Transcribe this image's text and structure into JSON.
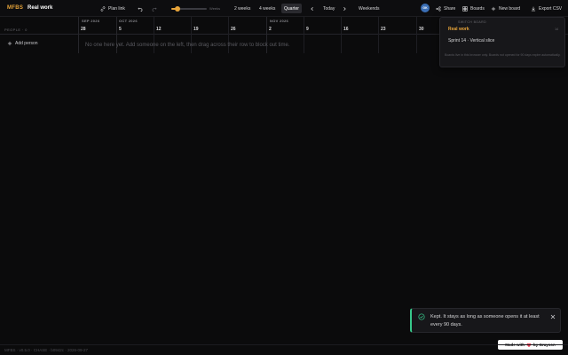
{
  "app": {
    "logo": "MFBS",
    "board_title": "Real work"
  },
  "toolbar": {
    "plan_link": "Plan link",
    "zoom_label": "Weeks",
    "zoom_level": 0.18,
    "views": [
      "2 weeks",
      "4 weeks",
      "Quarter"
    ],
    "active_view": "Quarter",
    "today": "Today",
    "weekends": "Weekends",
    "avatar_initials": "GK",
    "share": "Share",
    "boards": "Boards",
    "new_board": "New board",
    "export_csv": "Export CSV"
  },
  "timeline": {
    "people_label": "PEOPLE · 0",
    "months": [
      "SEP 2026",
      "OCT 2026",
      "NOV 2026"
    ],
    "days": [
      "28",
      "5",
      "12",
      "19",
      "26",
      "2",
      "9",
      "16",
      "23",
      "30"
    ],
    "add_person": "Add person",
    "empty_message": "No one here yet. Add someone on the left, then drag across their row to block out time."
  },
  "boards_popover": {
    "header": "SWITCH BOARD",
    "items": [
      {
        "name": "Real work",
        "date": "14",
        "current": true
      },
      {
        "name": "Sprint 14 · Vertical slice",
        "date": "",
        "current": false
      }
    ],
    "note": "Boards live in this browser only. Boards not opened for 90 days expire automatically."
  },
  "toast": {
    "message": "Kept. It stays as long as someone opens it at least every 90 days."
  },
  "badge": {
    "made_with": "Made with",
    "by": "by Grayson"
  },
  "footer": {
    "text": "MFBS · v0.5.0 · CHASE · b0942c · 2026-09-27"
  },
  "colors": {
    "accent": "#e8a53a",
    "success": "#37c88a",
    "background": "#0b0b0c"
  }
}
